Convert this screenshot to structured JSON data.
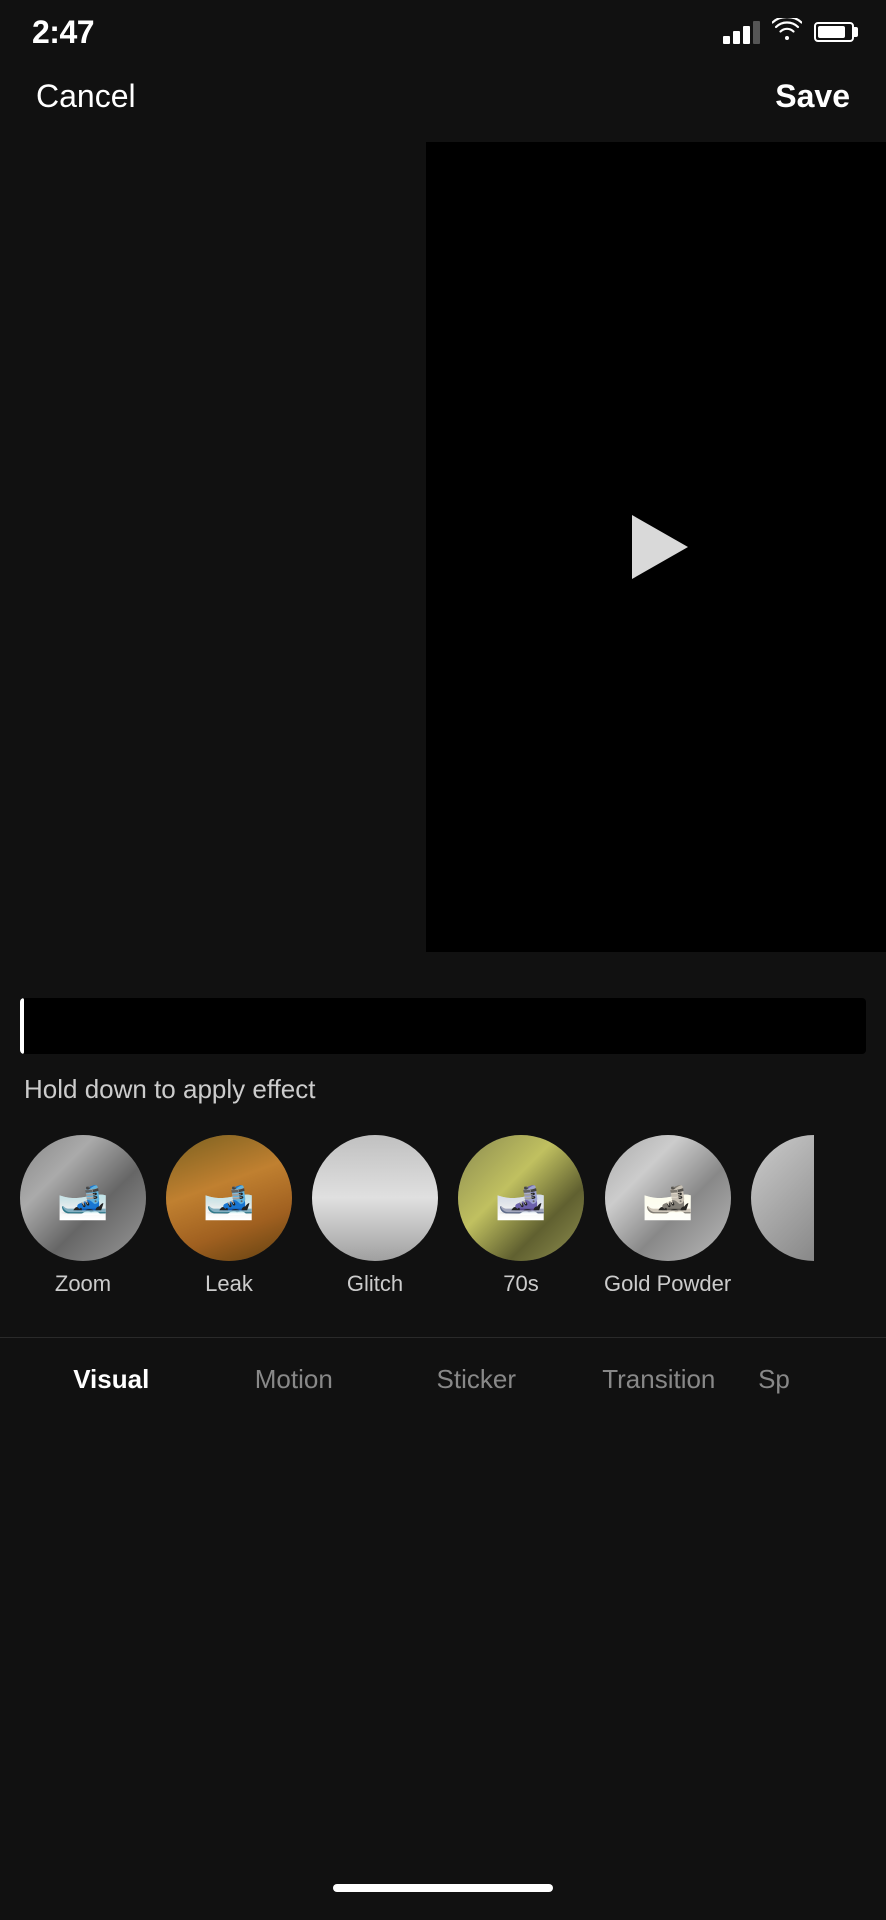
{
  "statusBar": {
    "time": "2:47",
    "signal": "signal-icon",
    "wifi": "wifi-icon",
    "battery": "battery-icon"
  },
  "topNav": {
    "cancelLabel": "Cancel",
    "saveLabel": "Save"
  },
  "videoPlayer": {
    "playIconLabel": "play-button"
  },
  "timeline": {
    "holdText": "Hold down to apply effect"
  },
  "effects": [
    {
      "id": "zoom",
      "label": "Zoom",
      "type": "skier-zoom"
    },
    {
      "id": "leak",
      "label": "Leak",
      "type": "skier-leak"
    },
    {
      "id": "glitch",
      "label": "Glitch",
      "type": "glitch"
    },
    {
      "id": "70s",
      "label": "70s",
      "type": "seventies"
    },
    {
      "id": "gold-powder",
      "label": "Gold Powder",
      "type": "gold-powder"
    },
    {
      "id": "partial",
      "label": "",
      "type": "partial"
    }
  ],
  "tabs": [
    {
      "id": "visual",
      "label": "Visual",
      "active": true
    },
    {
      "id": "motion",
      "label": "Motion",
      "active": false
    },
    {
      "id": "sticker",
      "label": "Sticker",
      "active": false
    },
    {
      "id": "transition",
      "label": "Transition",
      "active": false
    },
    {
      "id": "sp",
      "label": "Sp",
      "active": false,
      "partial": true
    }
  ],
  "homeIndicator": "home-indicator"
}
